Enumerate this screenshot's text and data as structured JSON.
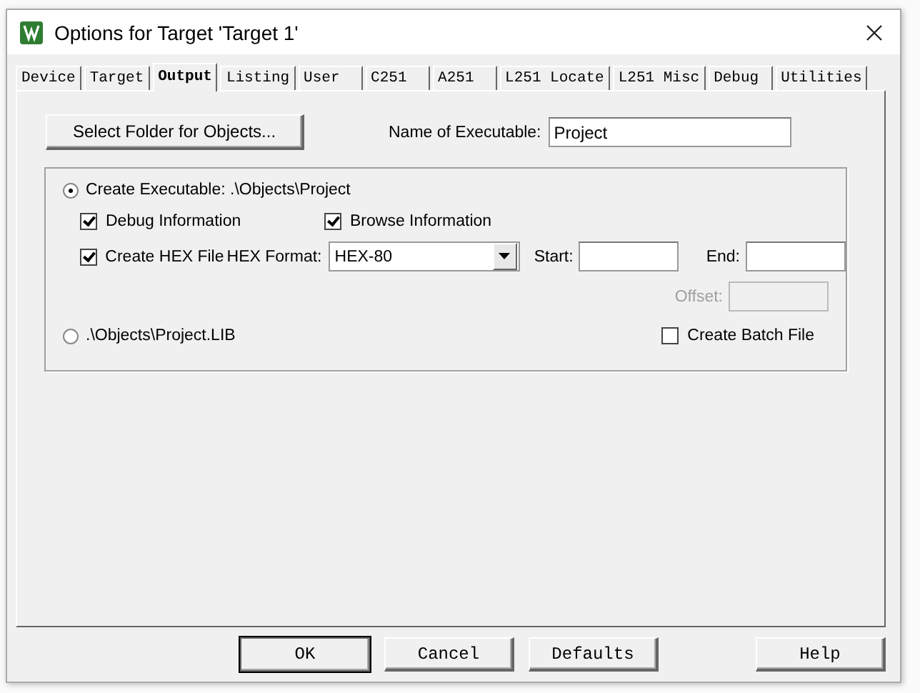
{
  "window": {
    "title": "Options for Target 'Target 1'"
  },
  "tabs": [
    {
      "label": "Device",
      "selected": false
    },
    {
      "label": "Target",
      "selected": false
    },
    {
      "label": "Output",
      "selected": true
    },
    {
      "label": "Listing",
      "selected": false
    },
    {
      "label": "User",
      "selected": false
    },
    {
      "label": "C251",
      "selected": false
    },
    {
      "label": "A251",
      "selected": false
    },
    {
      "label": "L251 Locate",
      "selected": false
    },
    {
      "label": "L251 Misc",
      "selected": false
    },
    {
      "label": "Debug",
      "selected": false
    },
    {
      "label": "Utilities",
      "selected": false
    }
  ],
  "select_folder_button": "Select Folder for Objects...",
  "executable_name": {
    "label": "Name of Executable:",
    "value": "Project"
  },
  "create_executable": {
    "label": "Create Executable:  .\\Objects\\Project",
    "selected": true
  },
  "debug_information": {
    "label": "Debug Information",
    "checked": true
  },
  "browse_information": {
    "label": "Browse Information",
    "checked": true
  },
  "create_hex_file": {
    "label": "Create HEX File",
    "checked": true
  },
  "hex_format": {
    "label": "HEX Format:",
    "value": "HEX-80"
  },
  "start": {
    "label": "Start:"
  },
  "end": {
    "label": "End:"
  },
  "offset": {
    "label": "Offset:",
    "disabled": true
  },
  "create_library": {
    "label": ".\\Objects\\Project.LIB",
    "selected": false
  },
  "create_batch_file": {
    "label": "Create Batch File",
    "checked": false
  },
  "buttons": [
    "OK",
    "Cancel",
    "Defaults",
    "Help"
  ]
}
